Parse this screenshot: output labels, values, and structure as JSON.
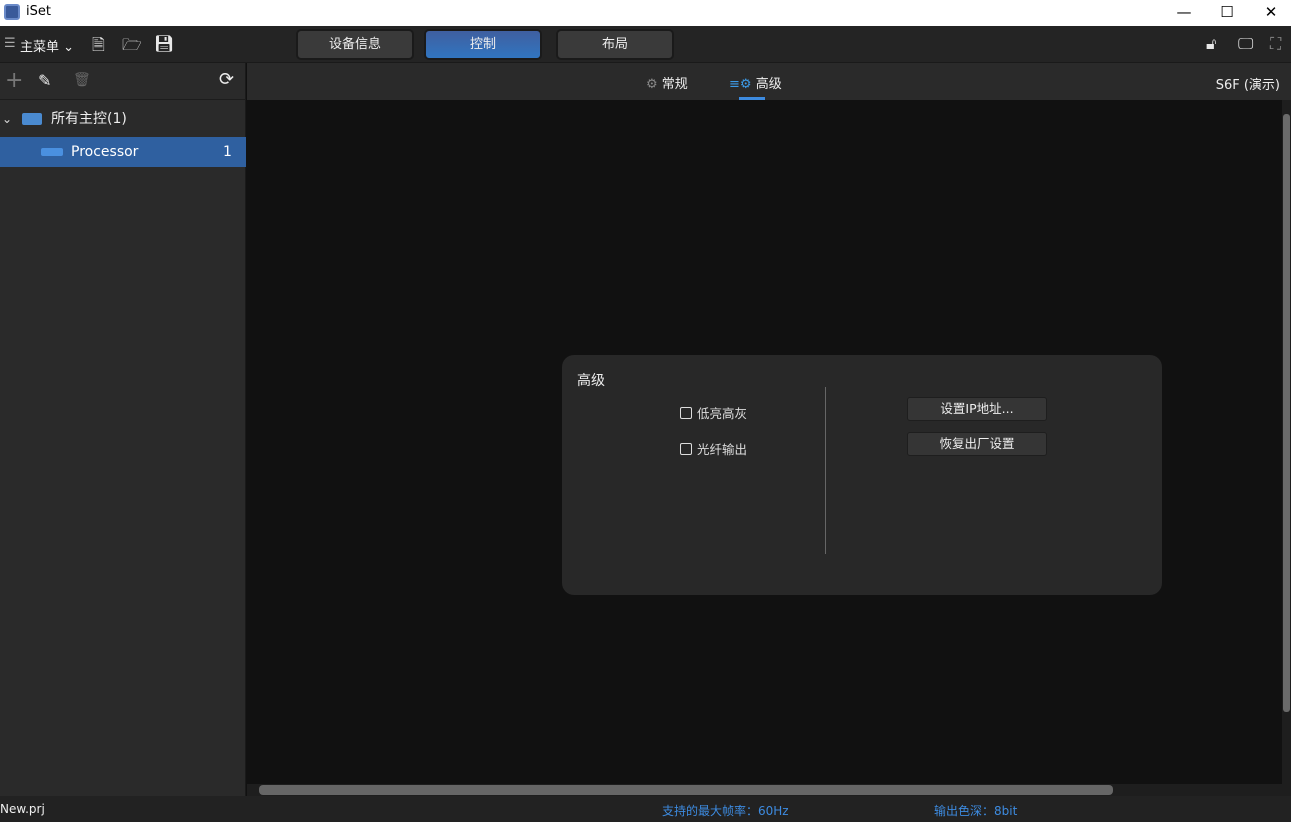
{
  "window": {
    "title": "iSet",
    "minimize": "—",
    "maximize": "☐",
    "close": "✕"
  },
  "toolbar": {
    "menu_label": "主菜单",
    "tabs": [
      "设备信息",
      "控制",
      "布局"
    ]
  },
  "sidebar": {
    "root_label": "所有主控(1)",
    "items": [
      {
        "label": "Processor",
        "count": "1"
      }
    ]
  },
  "subtabs": [
    "常规",
    "高级"
  ],
  "device_label": "S6F (演示)",
  "panel": {
    "title": "高级",
    "checkboxes": [
      "低亮高灰",
      "光纤输出"
    ],
    "buttons": [
      "设置IP地址...",
      "恢复出厂设置"
    ]
  },
  "status": {
    "file": "New.prj",
    "max_rate": "支持的最大帧率：60Hz",
    "color_depth": "输出色深：8bit"
  },
  "colors": {
    "accent": "#2f60a0",
    "status_text": "#3d8be0"
  }
}
